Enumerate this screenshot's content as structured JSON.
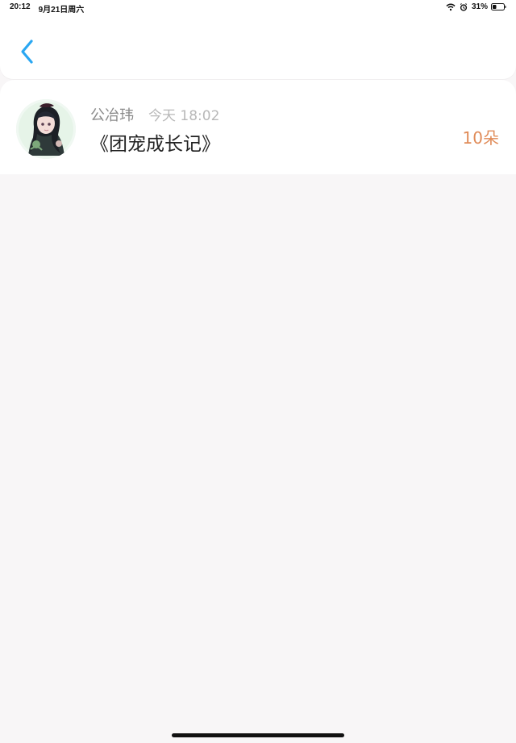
{
  "status_bar": {
    "time": "20:12",
    "date": "9月21日周六",
    "battery": "31%"
  },
  "header": {
    "back_icon": "chevron-left-icon"
  },
  "item": {
    "author": "公冶玮",
    "time": "今天 18:02",
    "title": "《团宠成长记》",
    "count": "10朵"
  },
  "colors": {
    "accent": "#2aa7f2",
    "count": "#e08b58",
    "background": "#f8f6f7"
  }
}
